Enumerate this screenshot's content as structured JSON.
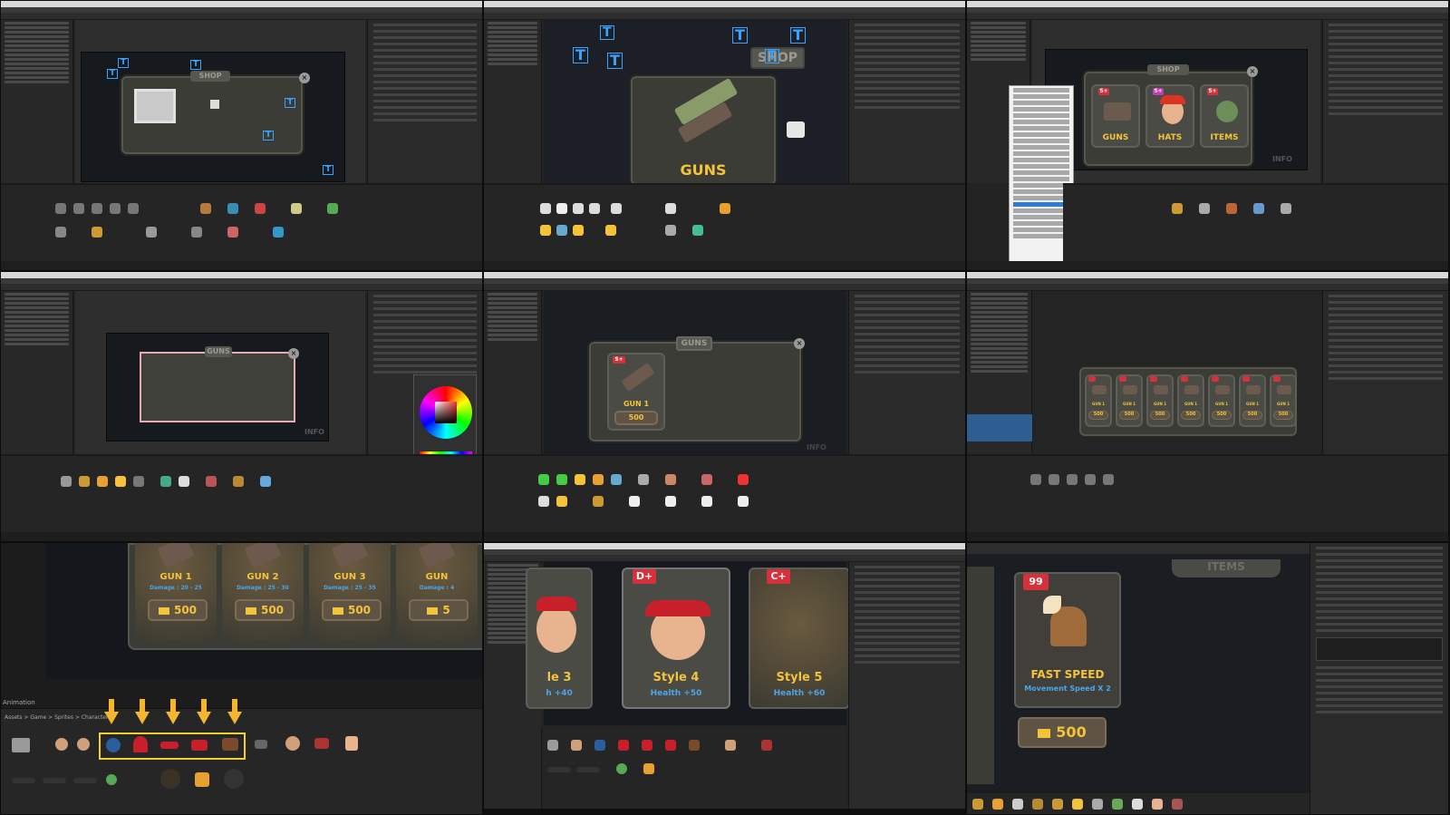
{
  "panels": {
    "p1": {
      "shop_plate": "SHOP"
    },
    "p2": {
      "shop_plate": "SHOP",
      "guns_label": "GUNS"
    },
    "p3": {
      "shop_plate": "SHOP",
      "items": [
        {
          "label": "GUNS",
          "badge": "S+"
        },
        {
          "label": "HATS",
          "badge": "S+"
        },
        {
          "label": "ITEMS",
          "badge": "S+"
        }
      ],
      "info": "INFO"
    },
    "p4": {
      "plate": "GUNS",
      "info": "INFO"
    },
    "p5": {
      "plate": "GUNS",
      "gun_name": "GUN 1",
      "price": "500",
      "badge": "S+",
      "info": "INFO"
    },
    "p6": {
      "gun_names": [
        "GUN 1",
        "GUN 1",
        "GUN 1",
        "GUN 1",
        "GUN 1",
        "GUN 1",
        "GUN 1"
      ],
      "prices": [
        "500",
        "500",
        "500",
        "500",
        "500",
        "500",
        "500"
      ]
    },
    "p7": {
      "guns": [
        {
          "name": "GUN 1",
          "damage": "Damage : 20 - 25",
          "price": "500"
        },
        {
          "name": "GUN 2",
          "damage": "Damage : 25 - 30",
          "price": "500"
        },
        {
          "name": "GUN 3",
          "damage": "Damage : 25 - 35",
          "price": "500"
        },
        {
          "name": "GUN",
          "damage": "Damage : 4",
          "price": "5"
        }
      ],
      "tab": "Animation",
      "breadcrumb": "Assets > Game > Sprites > Character"
    },
    "p8": {
      "styles": [
        {
          "name": "le 3",
          "health": "h +40"
        },
        {
          "name": "Style 4",
          "health": "Health +50",
          "badge": "D+"
        },
        {
          "name": "Style 5",
          "health": "Health +60",
          "badge": "C+"
        }
      ]
    },
    "p9": {
      "badge": "99",
      "title": "FAST SPEED",
      "subtitle": "Movement Speed X 2",
      "price": "500",
      "header": "ITEMS"
    }
  },
  "colors": {
    "editor_bg": "#232323",
    "gold": "#f3c33a",
    "badge_red": "#d8303a",
    "selection_blue": "#3aa3ff",
    "accent_arrow": "#f3b62c"
  }
}
